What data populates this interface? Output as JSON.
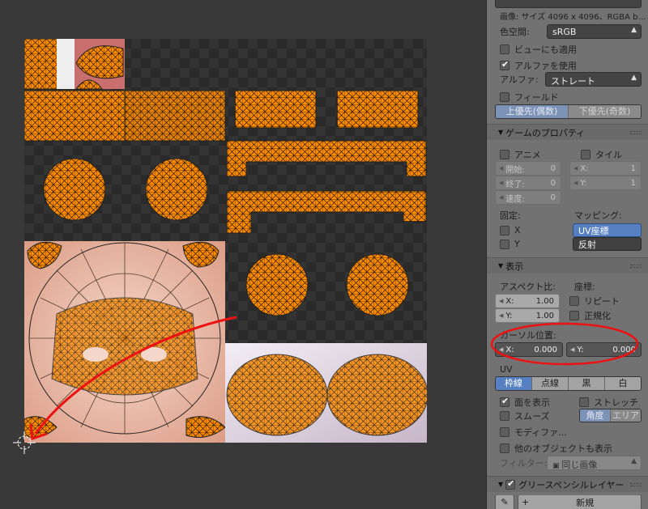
{
  "image": {
    "file_name": "...",
    "info_label": "画像: サイズ 4096 x 4096、RGBA b..."
  },
  "color_space": {
    "label": "色空間:",
    "value": "sRGB"
  },
  "view_as_render": {
    "label": "ビューにも適用",
    "checked": false
  },
  "use_alpha": {
    "label": "アルファを使用",
    "checked": true
  },
  "alpha": {
    "label": "アルファ:",
    "value": "ストレート"
  },
  "fields": {
    "label": "フィールド",
    "checked": false,
    "order": [
      "上優先(偶数)",
      "下優先(奇数)"
    ],
    "active_order": 0
  },
  "game_props": {
    "title": "ゲームのプロパティ",
    "anim_label": "アニメ",
    "anim_checked": false,
    "tiles_label": "タイル",
    "tiles_checked": false,
    "start": {
      "label": "開始:",
      "value": "0"
    },
    "end": {
      "label": "終了:",
      "value": "0"
    },
    "speed": {
      "label": "速度:",
      "value": "0"
    },
    "tile_x": {
      "label": "X:",
      "value": "1"
    },
    "tile_y": {
      "label": "Y:",
      "value": "1"
    },
    "clamp_label": "固定:",
    "clamp_x": "X",
    "clamp_y": "Y",
    "mapping_label": "マッピング:",
    "mapping_uv": "UV座標",
    "mapping_reflect": "反射"
  },
  "display": {
    "title": "表示",
    "aspect_label": "アスペクト比:",
    "aspect_x": {
      "label": "X:",
      "value": "1.00"
    },
    "aspect_y": {
      "label": "Y:",
      "value": "1.00"
    },
    "coords_label": "座標:",
    "repeat_label": "リピート",
    "normalize_label": "正規化",
    "cursor_label": "カーソル位置:",
    "cursor_x": {
      "label": "X:",
      "value": "0.000"
    },
    "cursor_y": {
      "label": "Y:",
      "value": "0.000"
    },
    "uv_label": "UV",
    "edge_styles": [
      "枠線",
      "点線",
      "黒",
      "白"
    ],
    "edge_active": 0,
    "draw_faces": {
      "label": "面を表示",
      "checked": true
    },
    "stretch": {
      "label": "ストレッチ",
      "checked": false
    },
    "smooth": {
      "label": "スムーズ",
      "checked": false
    },
    "stretch_modes": [
      "角度",
      "エリア"
    ],
    "modified": {
      "label": "モディファ...",
      "checked": false
    },
    "other_objects": {
      "label": "他のオブジェクトも表示",
      "checked": false
    },
    "filter_label": "フィルター:",
    "filter_value": "同じ画像"
  },
  "grease_pencil": {
    "title": "グリースペンシルレイヤー",
    "new_label": "新規"
  },
  "colors": {
    "uv_fill": "#ff8c00",
    "uv_edge": "#1c1c1c",
    "annotation": "#ee1111",
    "accent": "#5680c2"
  },
  "icons": [
    "triangle-down-icon",
    "checkbox-icon",
    "image-icon",
    "pencil-icon",
    "plus-icon",
    "cursor-crosshair-icon"
  ]
}
